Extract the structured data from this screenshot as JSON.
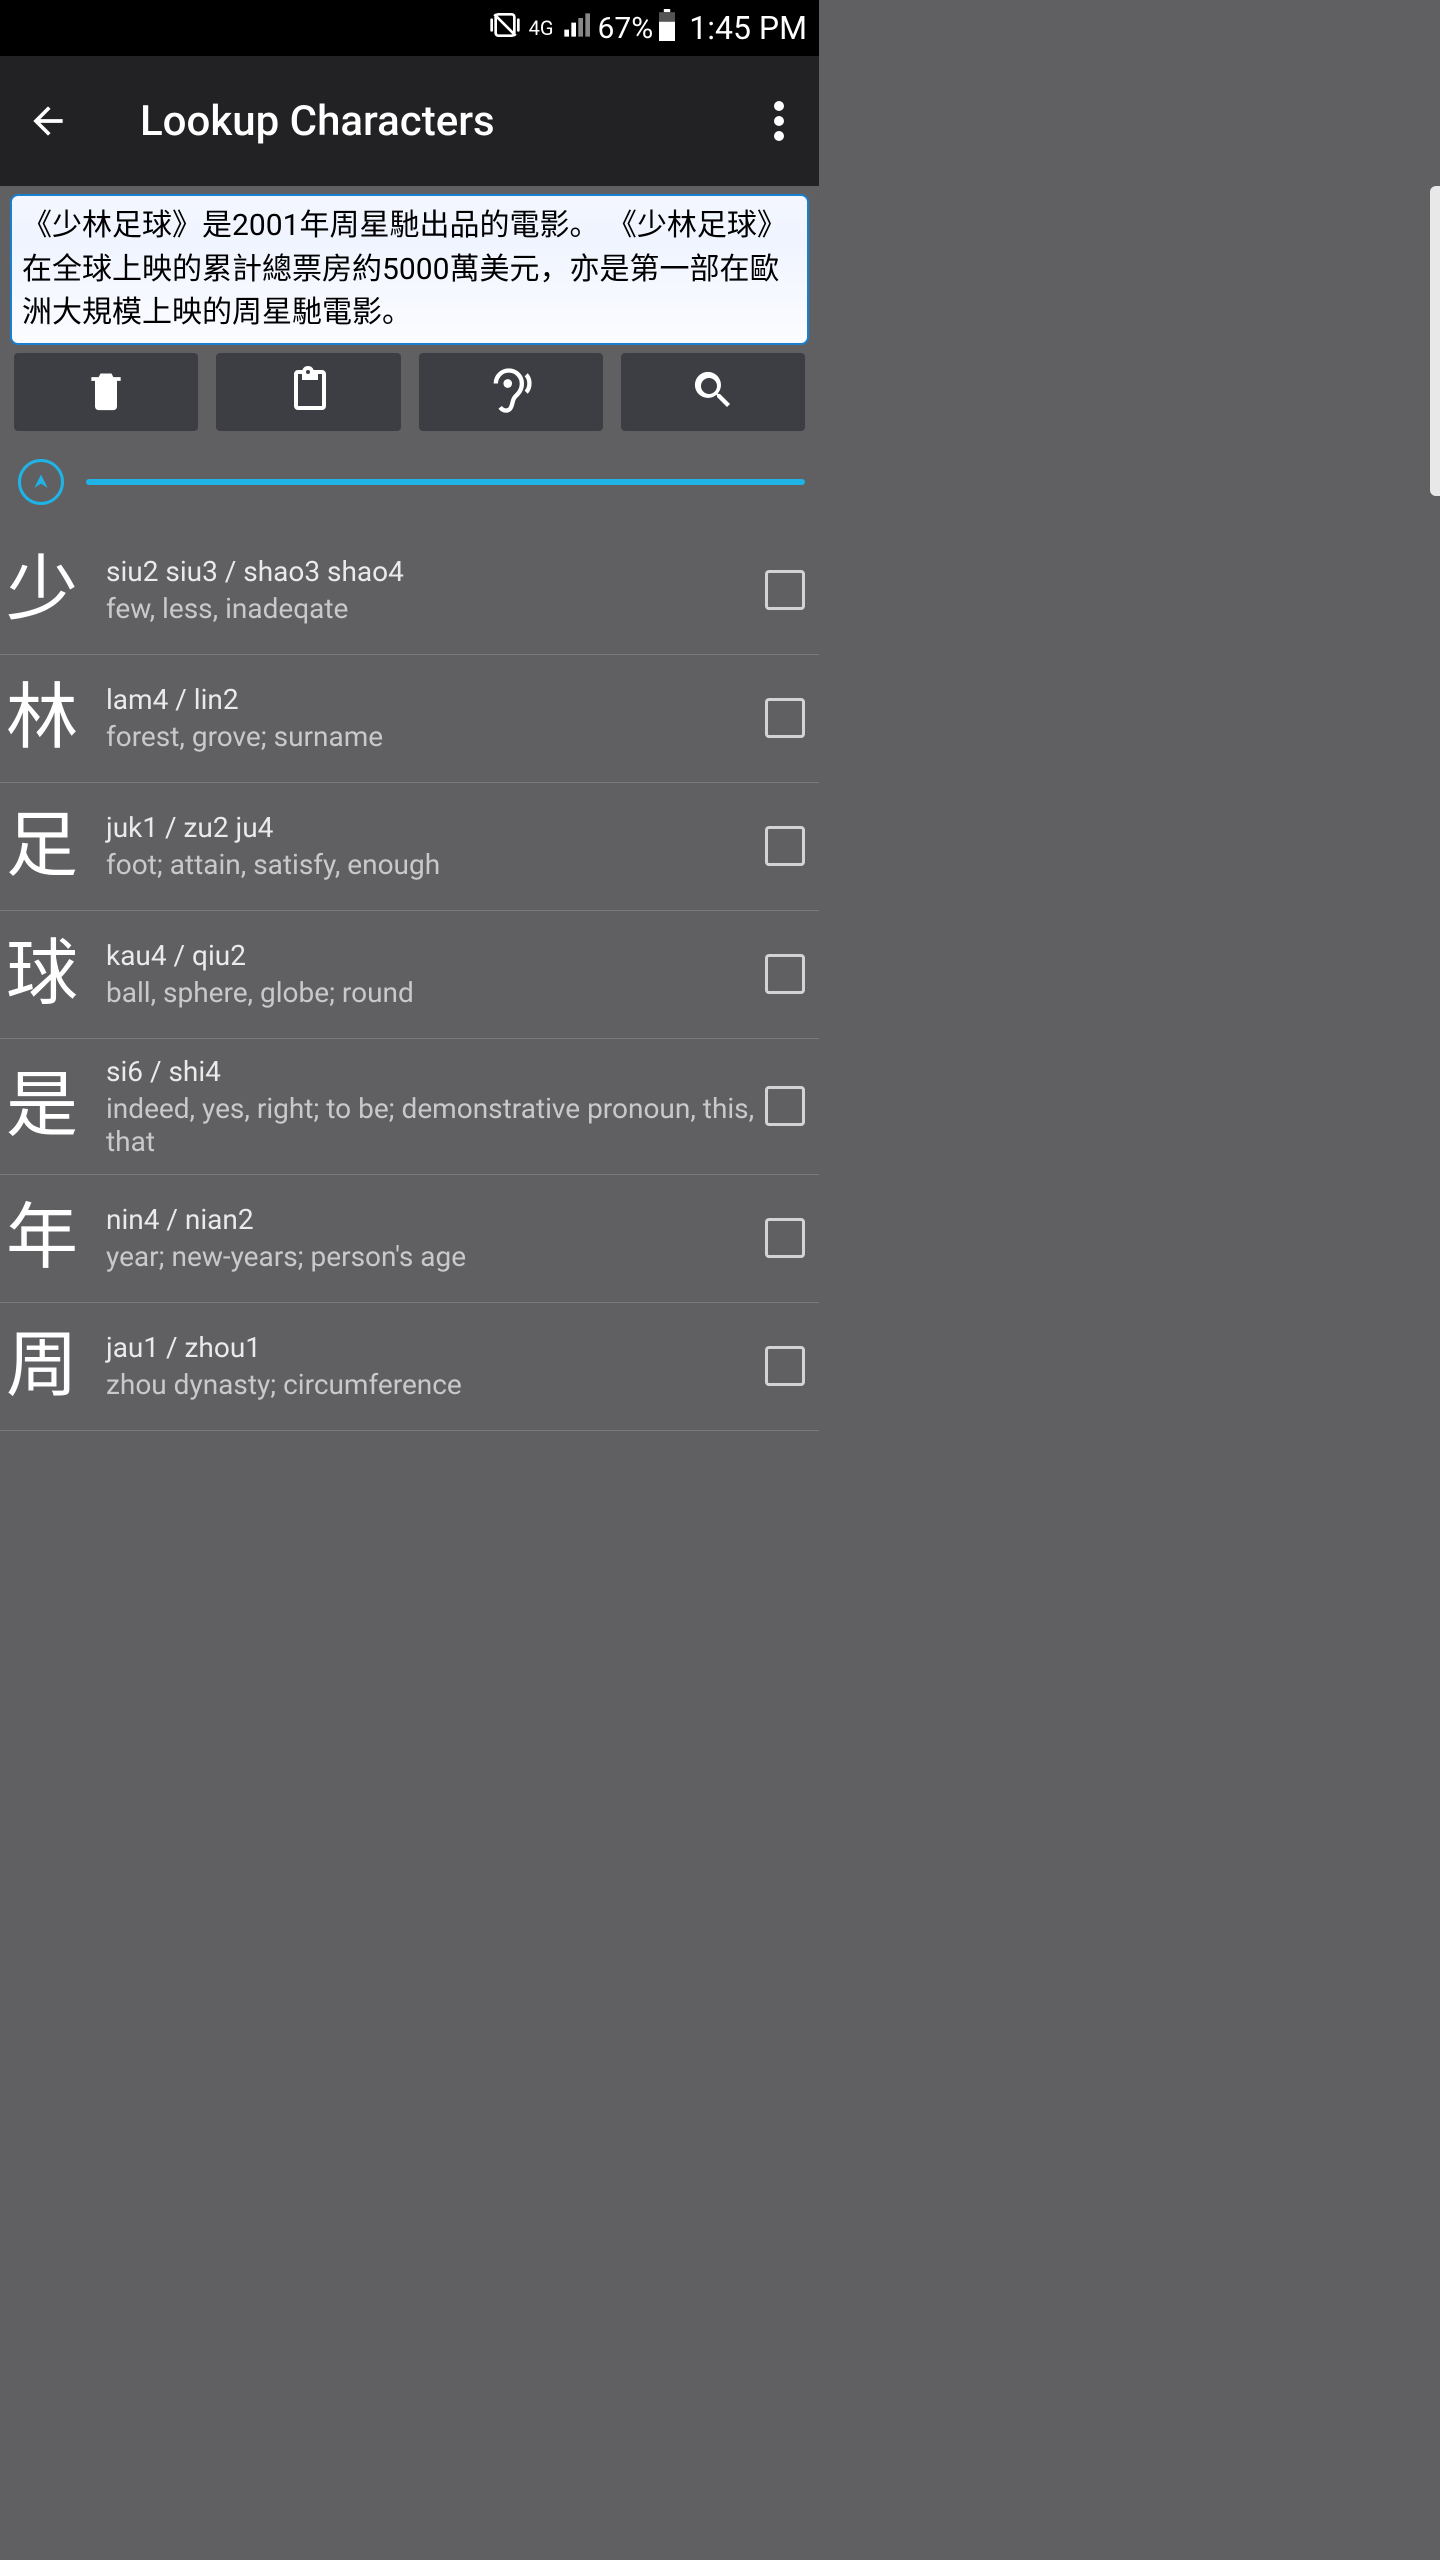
{
  "status": {
    "network_label": "4G",
    "battery_pct": "67%",
    "clock": "1:45 PM"
  },
  "appbar": {
    "title": "Lookup Characters"
  },
  "input": {
    "text": "《少林足球》是2001年周星馳出品的電影。 《少林足球》在全球上映的累計總票房約5000萬美元，亦是第一部在歐洲大規模上映的周星馳電影。"
  },
  "actions": {
    "delete": "delete",
    "paste": "paste",
    "listen": "listen",
    "search": "search"
  },
  "entries": [
    {
      "char": "少",
      "pron": "siu2 siu3  /  shao3 shao4",
      "defn": "few, less, inadeqate"
    },
    {
      "char": "林",
      "pron": "lam4  /  lin2",
      "defn": "forest, grove; surname"
    },
    {
      "char": "足",
      "pron": "juk1  /  zu2 ju4",
      "defn": "foot; attain, satisfy, enough"
    },
    {
      "char": "球",
      "pron": "kau4  /  qiu2",
      "defn": "ball, sphere, globe; round"
    },
    {
      "char": "是",
      "pron": "si6  /  shi4",
      "defn": "indeed, yes, right; to be; demonstrative pronoun, this, that"
    },
    {
      "char": "年",
      "pron": "nin4  /  nian2",
      "defn": "year; new-years; person's age"
    },
    {
      "char": "周",
      "pron": "jau1  /  zhou1",
      "defn": "zhou dynasty; circumference"
    }
  ]
}
